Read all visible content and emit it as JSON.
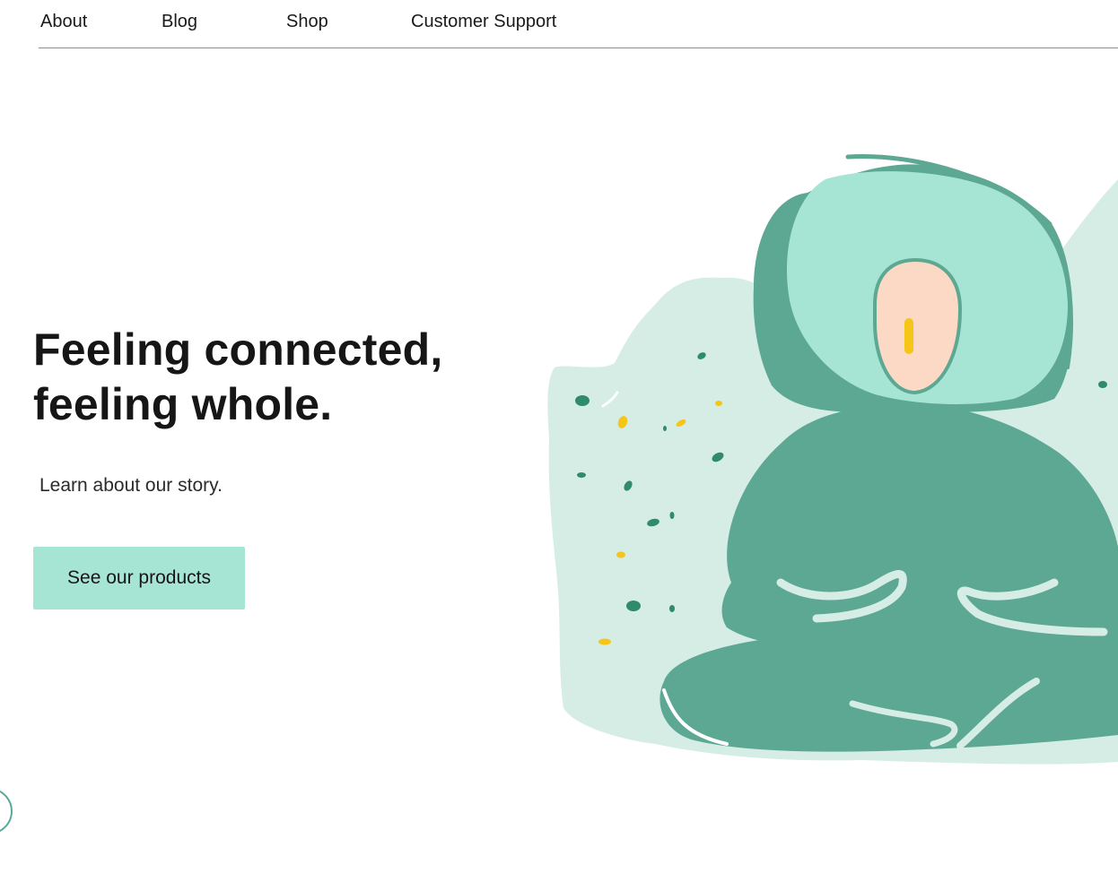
{
  "nav": {
    "items": [
      {
        "label": "About"
      },
      {
        "label": "Blog"
      },
      {
        "label": "Shop"
      },
      {
        "label": "Customer Support"
      }
    ]
  },
  "hero": {
    "title_line1": "Feeling connected,",
    "title_line2": "feeling whole.",
    "subtitle": "Learn about our story.",
    "cta_label": "See our products"
  },
  "colors": {
    "accent": "#a6e4d4",
    "figure_dark": "#5da892",
    "figure_light": "#a6e4d4",
    "background_blob": "#d6ede6",
    "face": "#fcd9c4",
    "highlight": "#f5c518",
    "text": "#161616"
  },
  "icons": {
    "illustration": "meditating-person-illustration",
    "chat": "chat-widget-icon"
  }
}
